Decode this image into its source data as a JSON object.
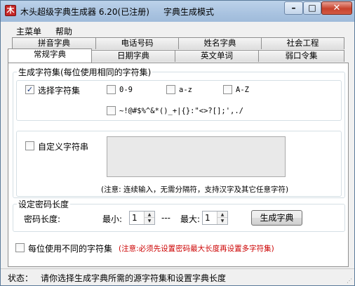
{
  "window": {
    "title": "木头超级字典生成器 6.20(已注册)",
    "mode": "字典生成模式",
    "icon_char": "木"
  },
  "menu": [
    "主菜单",
    "帮助"
  ],
  "tabs_back": [
    "拼音字典",
    "电话号码",
    "姓名字典",
    "社会工程"
  ],
  "tabs_front": [
    "常规字典",
    "日期字典",
    "英文单词",
    "弱口令集"
  ],
  "active_tab": "常规字典",
  "charset_group": {
    "title": "生成字符集(每位使用相同的字符集)",
    "select_charset": {
      "label": "选择字符集",
      "checked": true
    },
    "options": [
      {
        "label": "0-9",
        "checked": false
      },
      {
        "label": "a-z",
        "checked": false
      },
      {
        "label": "A-Z",
        "checked": false
      }
    ],
    "symbols": {
      "label": "~!@#$%^&*()_+|{}:\"<>?[];',./",
      "checked": false
    },
    "custom": {
      "label": "自定义字符串",
      "checked": false,
      "value": ""
    },
    "note": "(注意: 连续输入，无需分隔符，支持汉字及其它任意字符)"
  },
  "length_group": {
    "title": "设定密码长度",
    "label": "密码长度:",
    "min_label": "最小:",
    "min_value": "1",
    "dash": "---",
    "max_label": "最大:",
    "max_value": "1",
    "generate_button": "生成字典"
  },
  "per_position": {
    "label": "每位使用不同的字符集",
    "checked": false,
    "note": "(注意:必须先设置密码最大长度再设置多字符集)",
    "note_color": "#cc0000"
  },
  "status": {
    "label": "状态：",
    "text": "请你选择生成字典所需的源字符集和设置字典长度"
  }
}
